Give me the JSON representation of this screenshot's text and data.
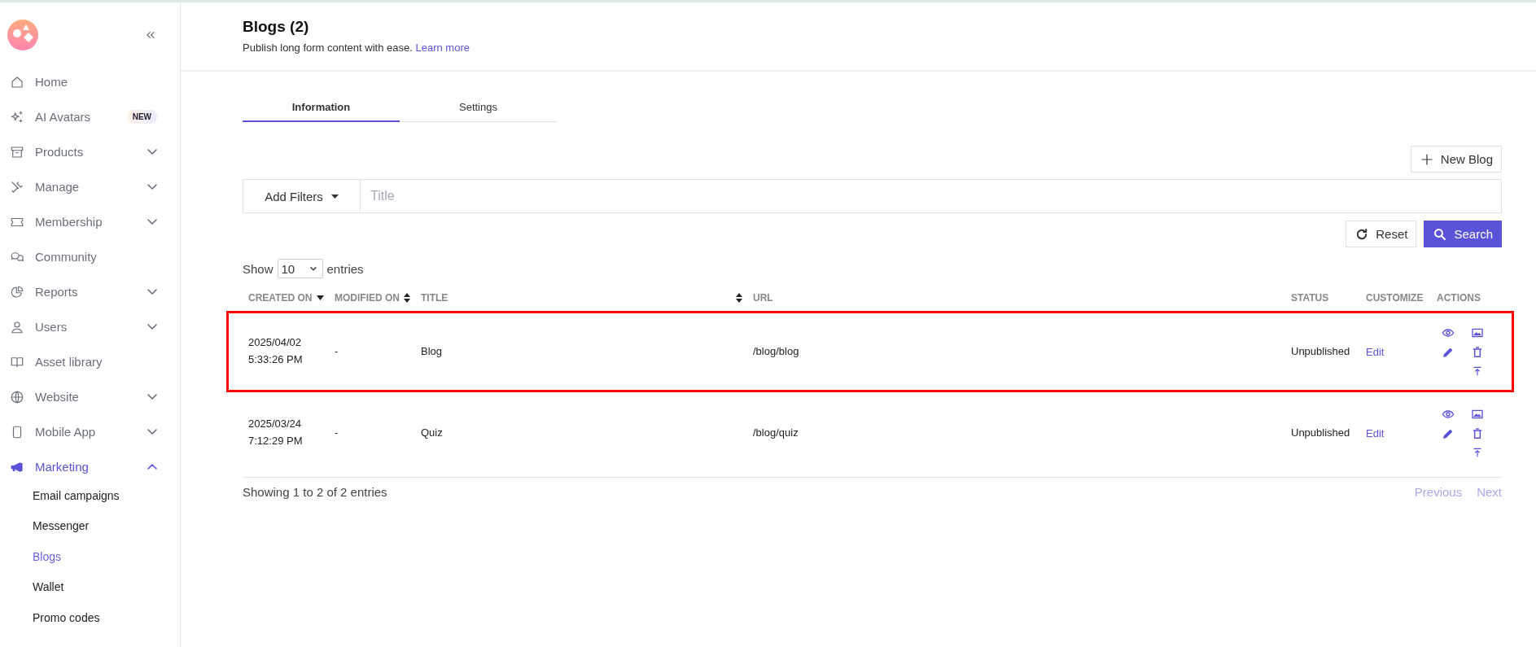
{
  "sidebar": {
    "items": [
      {
        "label": "Home",
        "selected": false
      },
      {
        "label": "AI Avatars",
        "badge": "NEW",
        "selected": false
      },
      {
        "label": "Products",
        "expanded": false,
        "selected": false
      },
      {
        "label": "Manage",
        "expanded": false,
        "selected": false
      },
      {
        "label": "Membership",
        "expanded": false,
        "selected": false
      },
      {
        "label": "Community",
        "selected": false
      },
      {
        "label": "Reports",
        "expanded": false,
        "selected": false
      },
      {
        "label": "Users",
        "expanded": false,
        "selected": false
      },
      {
        "label": "Asset library",
        "selected": false
      },
      {
        "label": "Website",
        "expanded": false,
        "selected": false
      },
      {
        "label": "Mobile App",
        "expanded": false,
        "selected": false
      },
      {
        "label": "Marketing",
        "expanded": true,
        "selected": true,
        "children": [
          {
            "label": "Email campaigns",
            "selected": false
          },
          {
            "label": "Messenger",
            "selected": false
          },
          {
            "label": "Blogs",
            "selected": true
          },
          {
            "label": "Wallet",
            "selected": false
          },
          {
            "label": "Promo codes",
            "selected": false
          }
        ]
      }
    ]
  },
  "header": {
    "title": "Blogs (2)",
    "subtitle": "Publish long form content with ease.",
    "link": "Learn more"
  },
  "tabs": [
    {
      "label": "Information",
      "selected": true
    },
    {
      "label": "Settings",
      "selected": false
    }
  ],
  "new_button": "New Blog",
  "filter": {
    "button": "Add Filters",
    "placeholder": "Title"
  },
  "reset_button": "Reset",
  "search_button": "Search",
  "page_size": {
    "before": "Show",
    "value": "10",
    "after": "entries"
  },
  "table": {
    "columns": [
      {
        "label": "CREATED ON",
        "sortable": true,
        "sorted": true
      },
      {
        "label": "MODIFIED ON",
        "sortable": true,
        "sorted": false
      },
      {
        "label": "TITLE",
        "sortable": true,
        "sorted": false
      },
      {
        "label": "URL",
        "sortable": false
      },
      {
        "label": "STATUS",
        "sortable": false
      },
      {
        "label": "CUSTOMIZE",
        "sortable": false
      },
      {
        "label": "ACTIONS",
        "sortable": false
      }
    ],
    "rows": [
      {
        "created_date": "2025/04/02",
        "created_time": "5:33:26 PM",
        "modified": "-",
        "title": "Blog",
        "url": "/blog/blog",
        "status": "Unpublished",
        "customize": "Edit",
        "highlighted": true
      },
      {
        "created_date": "2025/03/24",
        "created_time": "7:12:29 PM",
        "modified": "-",
        "title": "Quiz",
        "url": "/blog/quiz",
        "status": "Unpublished",
        "customize": "Edit",
        "highlighted": false
      }
    ]
  },
  "footer": {
    "info": "Showing 1 to 2 of 2 entries",
    "previous": "Previous",
    "next": "Next"
  }
}
